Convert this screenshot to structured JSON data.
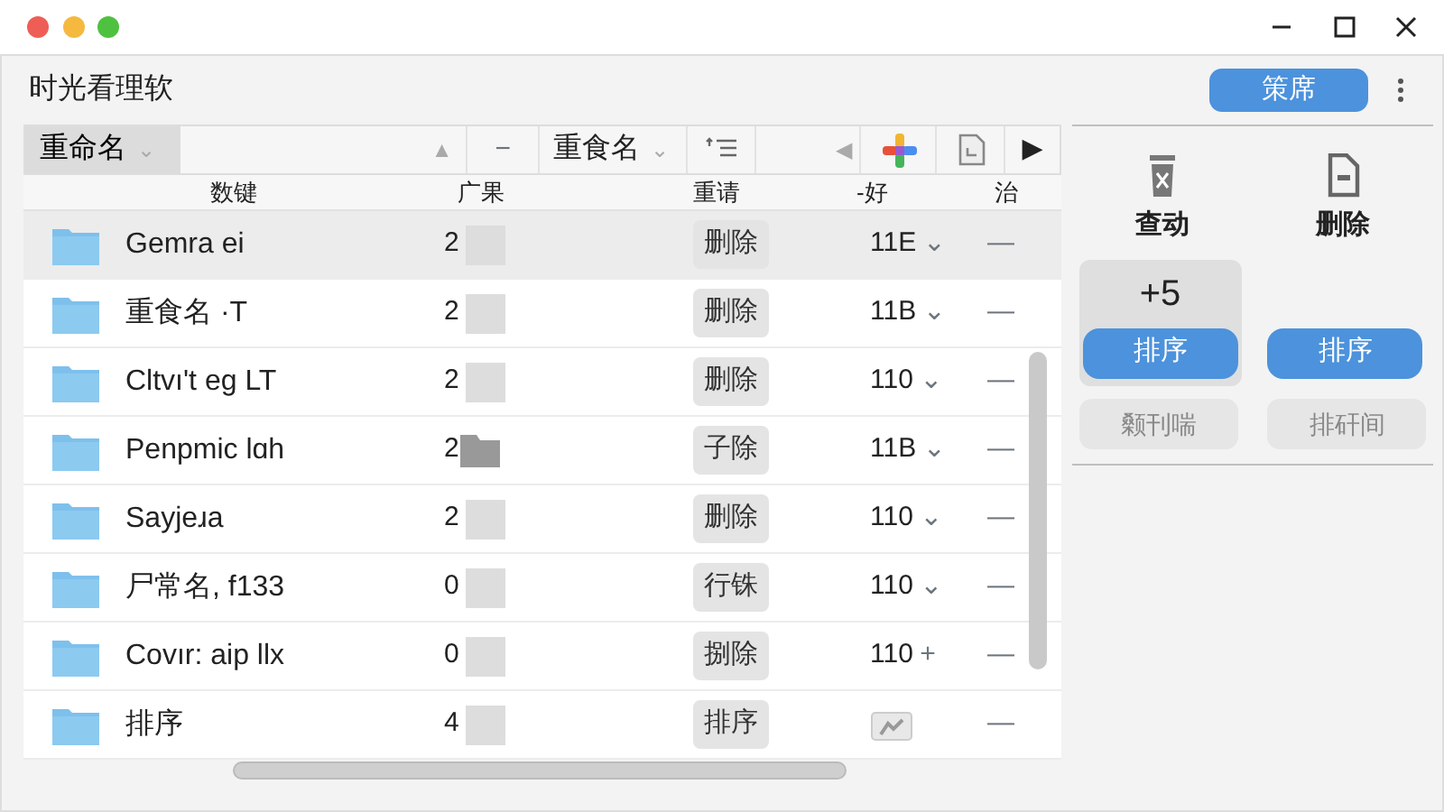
{
  "window": {
    "title": "时光看理软"
  },
  "header_button": "策席",
  "toolbar": {
    "sort_menu": "重命名",
    "caret": "⌄",
    "up_arrow": "▲",
    "dash": "−",
    "second_menu": "重食名",
    "left_arrow": "◀",
    "play": "▶"
  },
  "table": {
    "columns": [
      "数键",
      "广果",
      "重请",
      "-好",
      "治"
    ],
    "rows": [
      {
        "name": "Gemra ei",
        "count": "2",
        "kind": "plain",
        "action": "删除",
        "version": "11E",
        "caret": "⌄",
        "dash": "—",
        "selected": true
      },
      {
        "name": "重食名 ·T",
        "count": "2",
        "kind": "plain",
        "action": "删除",
        "version": "11B",
        "caret": "⌄",
        "dash": "—",
        "selected": false
      },
      {
        "name": "Cltvı't eg LT",
        "count": "2",
        "kind": "plain",
        "action": "删除",
        "version": "110",
        "caret": "⌄",
        "dash": "—",
        "selected": false
      },
      {
        "name": "Penpmic lɑh",
        "count": "2",
        "kind": "folder",
        "action": "子除",
        "version": "11B",
        "caret": "⌄",
        "dash": "—",
        "selected": false
      },
      {
        "name": "Sayjeɹa",
        "count": "2",
        "kind": "plain",
        "action": "删除",
        "version": "110",
        "caret": "⌄",
        "dash": "—",
        "selected": false
      },
      {
        "name": "尸常名, f133",
        "count": "0",
        "kind": "plain",
        "action": "行铢",
        "version": "110",
        "caret": "⌄",
        "dash": "—",
        "selected": false
      },
      {
        "name": "Covır: aip llx",
        "count": "0",
        "kind": "plain",
        "action": "捌除",
        "version": "110",
        "caret": "+",
        "dash": "—",
        "selected": false
      },
      {
        "name": "排序",
        "count": "4",
        "kind": "plain",
        "action": "排序",
        "dash": "—",
        "selected": false
      }
    ]
  },
  "side_panel": {
    "tools": [
      {
        "kind": "trash",
        "label": "查动"
      },
      {
        "kind": "document",
        "label": "删除"
      }
    ],
    "actions": [
      {
        "badge": "+5",
        "button": "排序",
        "selected": true
      },
      {
        "button": "排序",
        "selected": false
      }
    ],
    "secondary_buttons": [
      "颡刊喘",
      "排矸间"
    ]
  }
}
